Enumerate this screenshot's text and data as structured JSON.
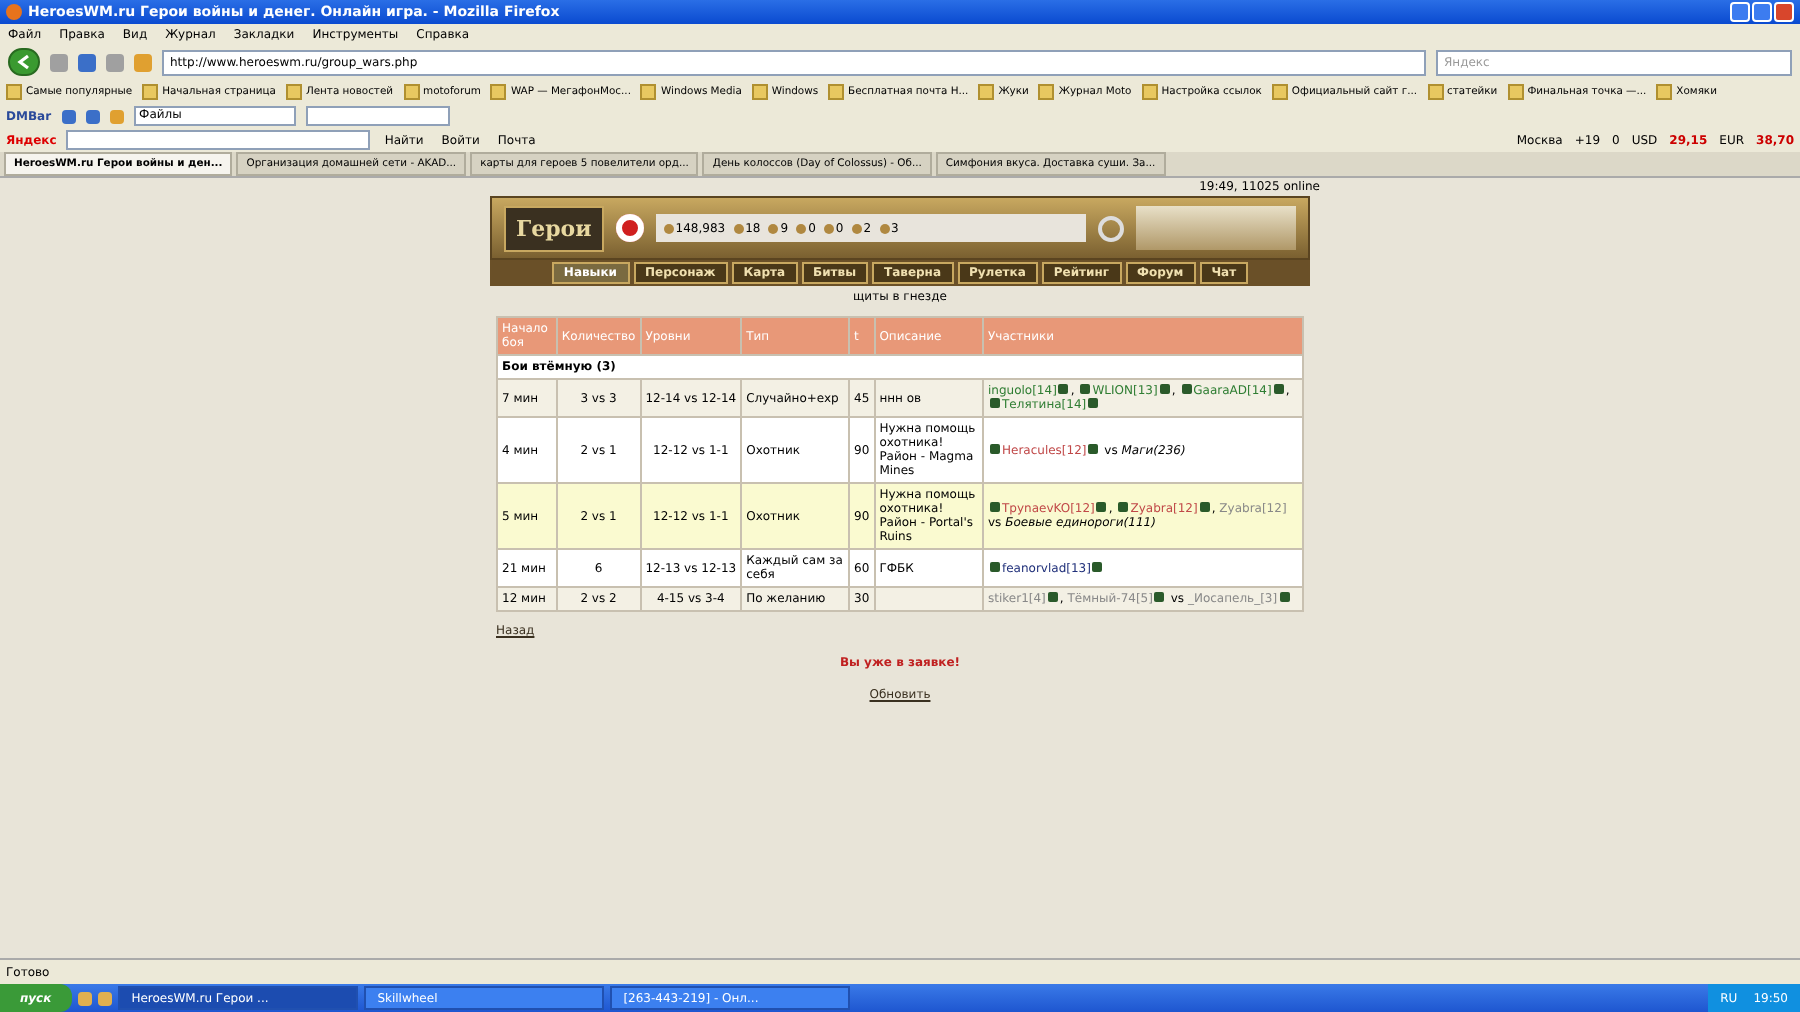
{
  "window": {
    "title": "HeroesWM.ru Герои войны и денег. Онлайн игра. - Mozilla Firefox"
  },
  "menu": [
    "Файл",
    "Правка",
    "Вид",
    "Журнал",
    "Закладки",
    "Инструменты",
    "Справка"
  ],
  "address": {
    "value": "http://www.heroeswm.ru/group_wars.php"
  },
  "search": {
    "placeholder": "Яндекс"
  },
  "bookmarks": [
    "Самые популярные",
    "Начальная страница",
    "Лента новостей",
    "motoforum",
    "WAP — МегафонМос...",
    "Windows Media",
    "Windows",
    "Бесплатная почта Н...",
    "Жуки",
    "Журнал Moto",
    "Настройка ссылок",
    "Официальный сайт г...",
    "статейки",
    "Финальная точка —...",
    "Хомяки"
  ],
  "dmbar": {
    "label": "DMBar",
    "dropdown": "Файлы"
  },
  "yandex_bar": {
    "label": "Яндекс",
    "find": "Найти",
    "login": "Войти",
    "mail": "Почта",
    "city": "Москва",
    "temp": "+19",
    "traffic": "0",
    "usd_label": "USD",
    "usd": "29,15",
    "eur_label": "EUR",
    "eur": "38,70"
  },
  "tabs": [
    {
      "label": "HeroesWM.ru Герои войны и ден...",
      "selected": true
    },
    {
      "label": "Организация домашней сети - AKAD...",
      "selected": false
    },
    {
      "label": "карты для героев 5 повелители орд...",
      "selected": false
    },
    {
      "label": "День колоссов (Day of Colossus) - Об...",
      "selected": false
    },
    {
      "label": "Симфония вкуса. Доставка суши. За...",
      "selected": false
    }
  ],
  "game": {
    "status": "19:49, 11025 online",
    "logo": "Герои",
    "resources": [
      "148,983",
      "18",
      "9",
      "0",
      "0",
      "2",
      "3"
    ],
    "nav": [
      {
        "label": "Навыки",
        "selected": true
      },
      {
        "label": "Персонаж",
        "selected": false
      },
      {
        "label": "Карта",
        "selected": false
      },
      {
        "label": "Битвы",
        "selected": false
      },
      {
        "label": "Таверна",
        "selected": false
      },
      {
        "label": "Рулетка",
        "selected": false
      },
      {
        "label": "Рейтинг",
        "selected": false
      },
      {
        "label": "Форум",
        "selected": false
      },
      {
        "label": "Чат",
        "selected": false
      }
    ],
    "subtitle": "щиты в гнезде"
  },
  "table": {
    "columns": [
      "Начало боя",
      "Количество",
      "Уровни",
      "Тип",
      "t",
      "Описание",
      "Участники"
    ],
    "group": "Бои втёмную (3)",
    "rows": [
      {
        "start": "7 мин",
        "count": "3 vs 3",
        "levels": "12-14 vs 12-14",
        "type": "Случайно+exp",
        "t": "45",
        "description": "ннн ов",
        "highlighted": false,
        "participants": [
          {
            "kind": "player",
            "text": "inguolo[14]",
            "color": "#2e7d32"
          },
          {
            "kind": "icon"
          },
          {
            "kind": "text",
            "text": ", "
          },
          {
            "kind": "icon"
          },
          {
            "kind": "player",
            "text": "WLION[13]",
            "color": "#2e7d32"
          },
          {
            "kind": "icon"
          },
          {
            "kind": "text",
            "text": ", "
          },
          {
            "kind": "icon"
          },
          {
            "kind": "player",
            "text": "GaaraAD[14]",
            "color": "#2e7d32"
          },
          {
            "kind": "icon"
          },
          {
            "kind": "text",
            "text": ", "
          },
          {
            "kind": "icon"
          },
          {
            "kind": "player",
            "text": "Телятина[14]",
            "color": "#2e7d32"
          },
          {
            "kind": "icon"
          }
        ]
      },
      {
        "start": "4 мин",
        "count": "2 vs 1",
        "levels": "12-12 vs 1-1",
        "type": "Охотник",
        "t": "90",
        "description": "Нужна помощь охотника! Район - Magma Mines",
        "highlighted": false,
        "participants": [
          {
            "kind": "icon"
          },
          {
            "kind": "player",
            "text": "Heracules[12]",
            "color": "#c04848"
          },
          {
            "kind": "icon"
          },
          {
            "kind": "text",
            "text": " vs "
          },
          {
            "kind": "italic",
            "text": "Маги(236)"
          }
        ]
      },
      {
        "start": "5 мин",
        "count": "2 vs 1",
        "levels": "12-12 vs 1-1",
        "type": "Охотник",
        "t": "90",
        "description": "Нужна помощь охотника! Район - Portal's Ruins",
        "highlighted": true,
        "participants": [
          {
            "kind": "icon"
          },
          {
            "kind": "player",
            "text": "TpynaevKO[12]",
            "color": "#c04848"
          },
          {
            "kind": "icon"
          },
          {
            "kind": "text",
            "text": ", "
          },
          {
            "kind": "icon"
          },
          {
            "kind": "player",
            "text": "Zyabra[12]",
            "color": "#c04848"
          },
          {
            "kind": "icon"
          },
          {
            "kind": "text",
            "text": ", "
          },
          {
            "kind": "player",
            "text": "Zyabra[12]",
            "color": "#888888"
          },
          {
            "kind": "text",
            "text": " vs "
          },
          {
            "kind": "italic",
            "text": "Боевые единороги(111)"
          }
        ]
      },
      {
        "start": "21 мин",
        "count": "6",
        "levels": "12-13 vs 12-13",
        "type": "Каждый сам за себя",
        "t": "60",
        "description": "ГФБК",
        "highlighted": false,
        "participants": [
          {
            "kind": "icon"
          },
          {
            "kind": "player",
            "text": "feanorvlad[13]",
            "color": "#20307a"
          },
          {
            "kind": "icon"
          }
        ]
      },
      {
        "start": "12 мин",
        "count": "2 vs 2",
        "levels": "4-15 vs 3-4",
        "type": "По желанию",
        "t": "30",
        "description": "",
        "highlighted": false,
        "participants": [
          {
            "kind": "player",
            "text": "stiker1[4]",
            "color": "#888888"
          },
          {
            "kind": "icon"
          },
          {
            "kind": "text",
            "text": ", "
          },
          {
            "kind": "player",
            "text": "Тёмный-74[5]",
            "color": "#888888"
          },
          {
            "kind": "icon"
          },
          {
            "kind": "text",
            "text": " vs "
          },
          {
            "kind": "player",
            "text": "_Иосапель_[3]",
            "color": "#888888"
          },
          {
            "kind": "icon"
          }
        ]
      }
    ]
  },
  "back_link": "Назад",
  "notice": "Вы уже в заявке!",
  "refresh_link": "Обновить",
  "status_bar": "Готово",
  "taskbar": {
    "start": "пуск",
    "tasks": [
      {
        "label": "HeroesWM.ru Герои ...",
        "selected": true
      },
      {
        "label": "Skillwheel",
        "selected": false
      },
      {
        "label": "[263-443-219] - Онл...",
        "selected": false
      }
    ],
    "lang": "RU",
    "clock": "19:50"
  }
}
